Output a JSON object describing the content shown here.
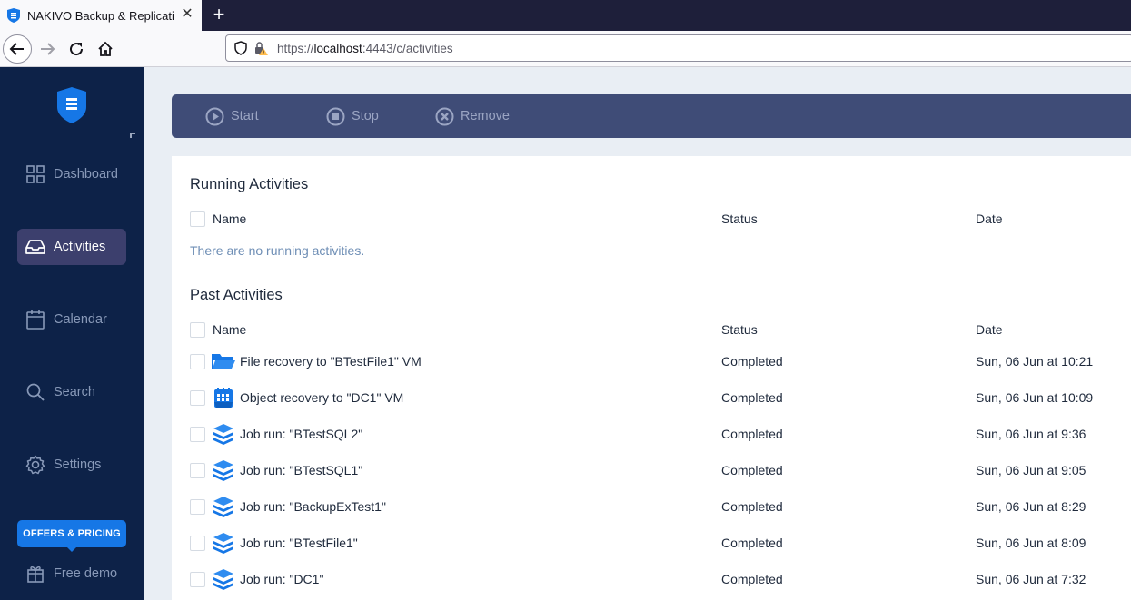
{
  "browser": {
    "tab_title": "NAKIVO Backup & Replication",
    "url_scheme": "https://",
    "url_host": "localhost",
    "url_rest": ":4443/c/activities"
  },
  "sidebar": {
    "items": [
      {
        "label": "Dashboard",
        "icon": "grid-icon"
      },
      {
        "label": "Activities",
        "icon": "inbox-icon",
        "active": true
      },
      {
        "label": "Calendar",
        "icon": "calendar-icon"
      },
      {
        "label": "Search",
        "icon": "search-icon"
      },
      {
        "label": "Settings",
        "icon": "gear-icon"
      }
    ],
    "offers_label": "OFFERS & PRICING",
    "free_demo_label": "Free demo"
  },
  "toolbar": {
    "start_label": "Start",
    "stop_label": "Stop",
    "remove_label": "Remove"
  },
  "running": {
    "title": "Running Activities",
    "columns": {
      "name": "Name",
      "status": "Status",
      "date": "Date"
    },
    "empty_message": "There are no running activities."
  },
  "past": {
    "title": "Past Activities",
    "columns": {
      "name": "Name",
      "status": "Status",
      "date": "Date"
    },
    "rows": [
      {
        "name": "File recovery to \"BTestFile1\" VM",
        "status": "Completed",
        "date": "Sun, 06 Jun at 10:21",
        "icon": "folder-icon"
      },
      {
        "name": "Object recovery to \"DC1\" VM",
        "status": "Completed",
        "date": "Sun, 06 Jun at 10:09",
        "icon": "object-recovery-icon"
      },
      {
        "name": "Job run: \"BTestSQL2\"",
        "status": "Completed",
        "date": "Sun, 06 Jun at 9:36",
        "icon": "layers-icon"
      },
      {
        "name": "Job run: \"BTestSQL1\"",
        "status": "Completed",
        "date": "Sun, 06 Jun at 9:05",
        "icon": "layers-icon"
      },
      {
        "name": "Job run: \"BackupExTest1\"",
        "status": "Completed",
        "date": "Sun, 06 Jun at 8:29",
        "icon": "layers-icon"
      },
      {
        "name": "Job run: \"BTestFile1\"",
        "status": "Completed",
        "date": "Sun, 06 Jun at 8:09",
        "icon": "layers-icon"
      },
      {
        "name": "Job run: \"DC1\"",
        "status": "Completed",
        "date": "Sun, 06 Jun at 7:32",
        "icon": "layers-icon"
      }
    ]
  }
}
